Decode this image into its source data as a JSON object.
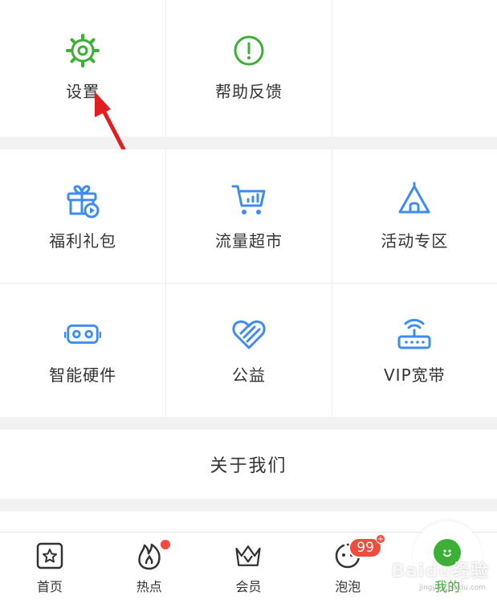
{
  "colors": {
    "green": "#3cb036",
    "blue": "#3f8cf0",
    "red": "#f04b3f",
    "arrow": "#e02020"
  },
  "top_grid": [
    {
      "label": "设置",
      "icon": "gear-icon"
    },
    {
      "label": "帮助反馈",
      "icon": "help-exclamation-icon"
    },
    {
      "label": "",
      "icon": ""
    }
  ],
  "services_row1": [
    {
      "label": "福利礼包",
      "icon": "gift-icon"
    },
    {
      "label": "流量超市",
      "icon": "shopping-cart-icon"
    },
    {
      "label": "活动专区",
      "icon": "tent-icon"
    }
  ],
  "services_row2": [
    {
      "label": "智能硬件",
      "icon": "vr-glasses-icon"
    },
    {
      "label": "公益",
      "icon": "heart-icon"
    },
    {
      "label": "VIP宽带",
      "icon": "router-icon"
    }
  ],
  "about": {
    "label": "关于我们"
  },
  "tabbar": {
    "items": [
      {
        "label": "首页",
        "icon": "home-star-icon"
      },
      {
        "label": "热点",
        "icon": "flame-icon"
      },
      {
        "label": "会员",
        "icon": "crown-icon"
      },
      {
        "label": "泡泡",
        "icon": "bubble-face-icon",
        "badge": "99"
      },
      {
        "label": "我的",
        "icon": "profile-face-icon",
        "active": true
      }
    ]
  },
  "watermark": {
    "text": "Baidu经验",
    "sub": "jingyan.baidu.com"
  }
}
